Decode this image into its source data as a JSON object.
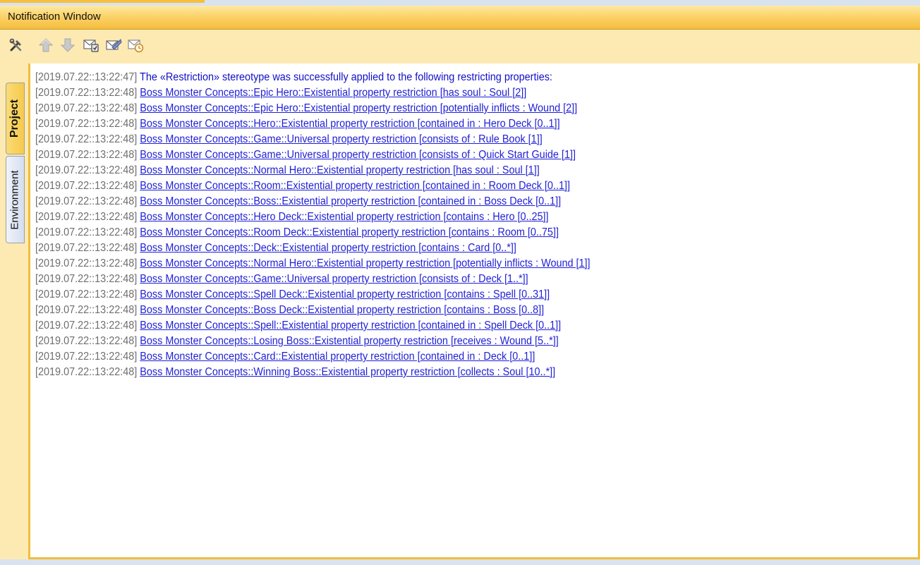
{
  "window": {
    "title": "Notification Window"
  },
  "toolbar": {
    "buttons": [
      {
        "icon": "tools-icon"
      },
      {
        "icon": "arrow-up-icon"
      },
      {
        "icon": "arrow-down-icon"
      },
      {
        "icon": "clear-messages-icon"
      },
      {
        "icon": "mark-read-icon"
      },
      {
        "icon": "timestamp-message-icon"
      }
    ]
  },
  "sidebar": {
    "tabs": [
      {
        "label": "Project"
      },
      {
        "label": "Environment"
      }
    ]
  },
  "log": {
    "header": {
      "timestamp": "[2019.07.22::13:22:47]",
      "text": "The «Restriction» stereotype was successfully applied to the following restricting properties:"
    },
    "entries": [
      {
        "timestamp": "[2019.07.22::13:22:48]",
        "link": "Boss Monster Concepts::Epic Hero::Existential property restriction [has soul : Soul [2]]"
      },
      {
        "timestamp": "[2019.07.22::13:22:48]",
        "link": "Boss Monster Concepts::Epic Hero::Existential property restriction [potentially inflicts : Wound [2]]"
      },
      {
        "timestamp": "[2019.07.22::13:22:48]",
        "link": "Boss Monster Concepts::Hero::Existential property restriction [contained in : Hero Deck [0..1]]"
      },
      {
        "timestamp": "[2019.07.22::13:22:48]",
        "link": "Boss Monster Concepts::Game::Universal property restriction [consists of : Rule Book [1]]"
      },
      {
        "timestamp": "[2019.07.22::13:22:48]",
        "link": "Boss Monster Concepts::Game::Universal property restriction [consists of : Quick Start Guide [1]]"
      },
      {
        "timestamp": "[2019.07.22::13:22:48]",
        "link": "Boss Monster Concepts::Normal Hero::Existential property restriction [has soul : Soul [1]]"
      },
      {
        "timestamp": "[2019.07.22::13:22:48]",
        "link": "Boss Monster Concepts::Room::Existential property restriction [contained in : Room Deck [0..1]]"
      },
      {
        "timestamp": "[2019.07.22::13:22:48]",
        "link": "Boss Monster Concepts::Boss::Existential property restriction [contained in : Boss Deck [0..1]]"
      },
      {
        "timestamp": "[2019.07.22::13:22:48]",
        "link": "Boss Monster Concepts::Hero Deck::Existential property restriction [contains : Hero [0..25]]"
      },
      {
        "timestamp": "[2019.07.22::13:22:48]",
        "link": "Boss Monster Concepts::Room Deck::Existential property restriction [contains : Room [0..75]]"
      },
      {
        "timestamp": "[2019.07.22::13:22:48]",
        "link": "Boss Monster Concepts::Deck::Existential property restriction [contains : Card [0..*]]"
      },
      {
        "timestamp": "[2019.07.22::13:22:48]",
        "link": "Boss Monster Concepts::Normal Hero::Existential property restriction [potentially inflicts : Wound [1]]"
      },
      {
        "timestamp": "[2019.07.22::13:22:48]",
        "link": "Boss Monster Concepts::Game::Universal property restriction [consists of : Deck [1..*]]"
      },
      {
        "timestamp": "[2019.07.22::13:22:48]",
        "link": "Boss Monster Concepts::Spell Deck::Existential property restriction [contains : Spell [0..31]]"
      },
      {
        "timestamp": "[2019.07.22::13:22:48]",
        "link": "Boss Monster Concepts::Boss Deck::Existential property restriction [contains : Boss [0..8]]"
      },
      {
        "timestamp": "[2019.07.22::13:22:48]",
        "link": "Boss Monster Concepts::Spell::Existential property restriction [contained in : Spell Deck [0..1]]"
      },
      {
        "timestamp": "[2019.07.22::13:22:48]",
        "link": "Boss Monster Concepts::Losing Boss::Existential property restriction [receives : Wound [5..*]]"
      },
      {
        "timestamp": "[2019.07.22::13:22:48]",
        "link": "Boss Monster Concepts::Card::Existential property restriction [contained in : Deck [0..1]]"
      },
      {
        "timestamp": "[2019.07.22::13:22:48]",
        "link": "Boss Monster Concepts::Winning Boss::Existential property restriction [collects : Soul [10..*]]"
      }
    ]
  },
  "colors": {
    "title_bar": "#fbd36a",
    "toolbar_bg": "#fdeab2",
    "frame_border": "#f0be3c",
    "timestamp_text": "#6e6e6e",
    "link_text": "#1f1fd6"
  }
}
